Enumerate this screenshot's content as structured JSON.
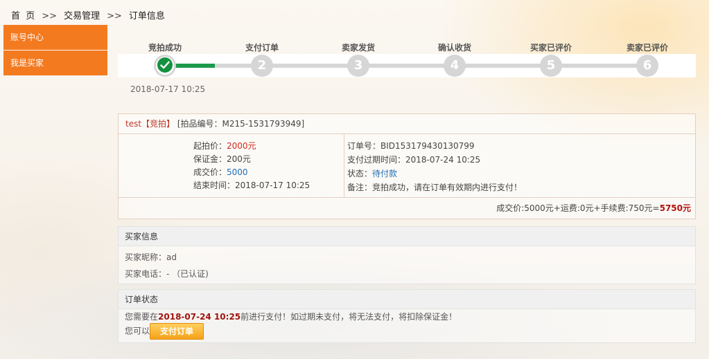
{
  "breadcrumb": {
    "home": "首  页",
    "sep": ">>",
    "level2": "交易管理",
    "level3": "订单信息"
  },
  "sidebar": {
    "items": [
      {
        "label": "账号中心"
      },
      {
        "label": "我是买家"
      }
    ]
  },
  "steps": {
    "labels": [
      "竞拍成功",
      "支付订单",
      "卖家发货",
      "确认收货",
      "买家已评价",
      "卖家已评价"
    ],
    "numbers": [
      "2",
      "3",
      "4",
      "5",
      "6"
    ],
    "current_date": "2018-07-17 10:25"
  },
  "order": {
    "title": "test【竞拍】",
    "lot": "[拍品编号：M215-1531793949]",
    "start_price_label": "起拍价：",
    "start_price": "2000元",
    "deposit_label": "保证金：",
    "deposit": "200元",
    "deal_price_label": "成交价：",
    "deal_price": "5000",
    "end_time_label": "结束时间：",
    "end_time": "2018-07-17 10:25",
    "order_no_label": "订单号：",
    "order_no": "BID153179430130799",
    "pay_expire_label": "支付过期时间：",
    "pay_expire": "2018-07-24 10:25",
    "status_label": "状态：",
    "status": "待付款",
    "remark_label": "备注：",
    "remark": "竞拍成功，请在订单有效期内进行支付！",
    "summary": "成交价:5000元+运费:0元+手续费:750元=",
    "total": "5750元"
  },
  "buyer": {
    "heading": "买家信息",
    "nickname_label": "买家昵称：",
    "nickname": "ad",
    "phone_label": "买家电话：",
    "phone": "- （已认证)"
  },
  "order_status": {
    "heading": "订单状态",
    "msg_prefix": "您需要在",
    "deadline": "2018-07-24 10:25",
    "msg_suffix": "前进行支付！如过期未支付，将无法支付，将扣除保证金！",
    "action_prefix": "您可以",
    "pay_button": "支付订单"
  },
  "colors": {
    "accent": "#f47a20",
    "progress": "#14913f",
    "price_red": "#d0281c",
    "status_blue": "#1f6fb6"
  }
}
